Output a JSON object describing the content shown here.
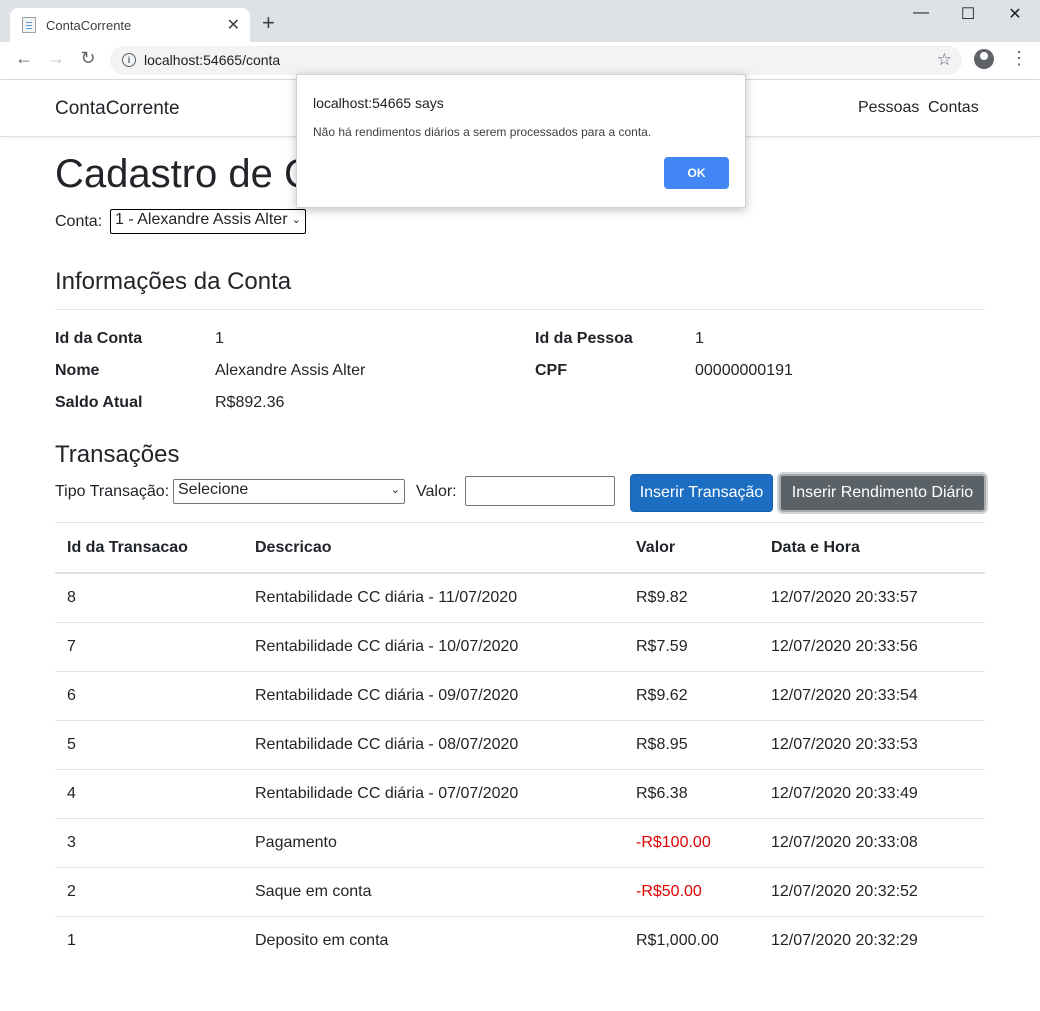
{
  "browser": {
    "tab_title": "ContaCorrente",
    "url": "localhost:54665/conta"
  },
  "navbar": {
    "brand": "ContaCorrente",
    "links": [
      "Pessoas",
      "Contas"
    ]
  },
  "page": {
    "title": "Cadastro de C",
    "conta_label": "Conta:",
    "conta_selected": "1 - Alexandre Assis Alter"
  },
  "info": {
    "heading": "Informações da Conta",
    "id_conta_label": "Id da Conta",
    "id_conta": "1",
    "nome_label": "Nome",
    "nome": "Alexandre Assis Alter",
    "saldo_label": "Saldo Atual",
    "saldo": "R$892.36",
    "id_pessoa_label": "Id da Pessoa",
    "id_pessoa": "1",
    "cpf_label": "CPF",
    "cpf": "00000000191"
  },
  "transacoes": {
    "heading": "Transações",
    "tipo_label": "Tipo Transação:",
    "tipo_selected": "Selecione",
    "valor_label": "Valor:",
    "valor_value": "",
    "btn_inserir": "Inserir Transação",
    "btn_rendimento": "Inserir Rendimento Diário",
    "columns": [
      "Id da Transacao",
      "Descricao",
      "Valor",
      "Data e Hora"
    ],
    "rows": [
      [
        "8",
        "Rentabilidade CC diária - 11/07/2020",
        "R$9.82",
        "12/07/2020 20:33:57"
      ],
      [
        "7",
        "Rentabilidade CC diária - 10/07/2020",
        "R$7.59",
        "12/07/2020 20:33:56"
      ],
      [
        "6",
        "Rentabilidade CC diária - 09/07/2020",
        "R$9.62",
        "12/07/2020 20:33:54"
      ],
      [
        "5",
        "Rentabilidade CC diária - 08/07/2020",
        "R$8.95",
        "12/07/2020 20:33:53"
      ],
      [
        "4",
        "Rentabilidade CC diária - 07/07/2020",
        "R$6.38",
        "12/07/2020 20:33:49"
      ],
      [
        "3",
        "Pagamento",
        "-R$100.00",
        "12/07/2020 20:33:08"
      ],
      [
        "2",
        "Saque em conta",
        "-R$50.00",
        "12/07/2020 20:32:52"
      ],
      [
        "1",
        "Deposito em conta",
        "R$1,000.00",
        "12/07/2020 20:32:29"
      ]
    ]
  },
  "dialog": {
    "title": "localhost:54665 says",
    "message": "Não há rendimentos diários a serem processados para a conta.",
    "ok_label": "OK"
  },
  "colors": {
    "primary": "#1b6ec2",
    "secondary": "#5a6268",
    "negative": "#e00000",
    "dialog_ok": "#4285f4"
  }
}
